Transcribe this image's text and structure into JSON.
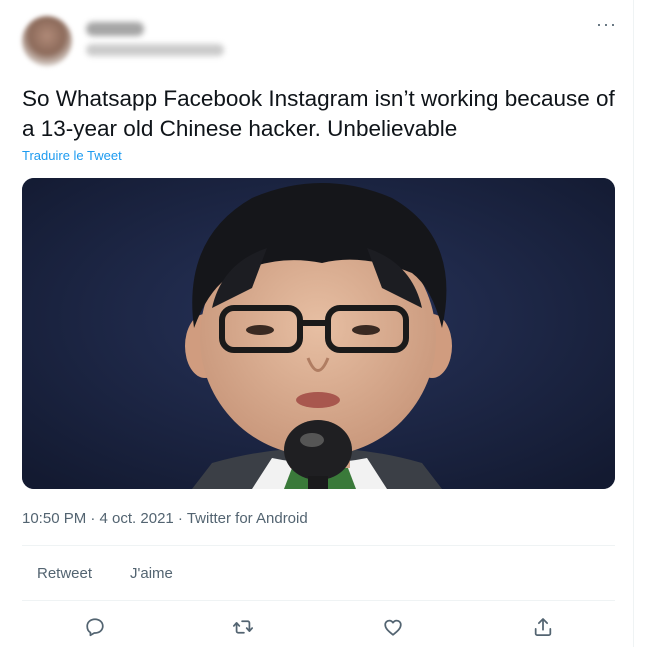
{
  "tweet": {
    "more_label": "···",
    "text": "So Whatsapp Facebook Instagram isn’t working because of a 13-year old Chinese hacker. Unbelievable",
    "translate_label": "Traduire le Tweet",
    "meta": "10:50 PM · 4 oct. 2021 · Twitter for Android",
    "retweets_label": "Retweet",
    "likes_label": "J'aime"
  },
  "icons": [
    "reply-icon",
    "retweet-icon",
    "like-icon",
    "share-icon"
  ],
  "colors": {
    "link": "#1d9bf0",
    "secondary_text": "#536471",
    "divider": "#eff3f4"
  }
}
